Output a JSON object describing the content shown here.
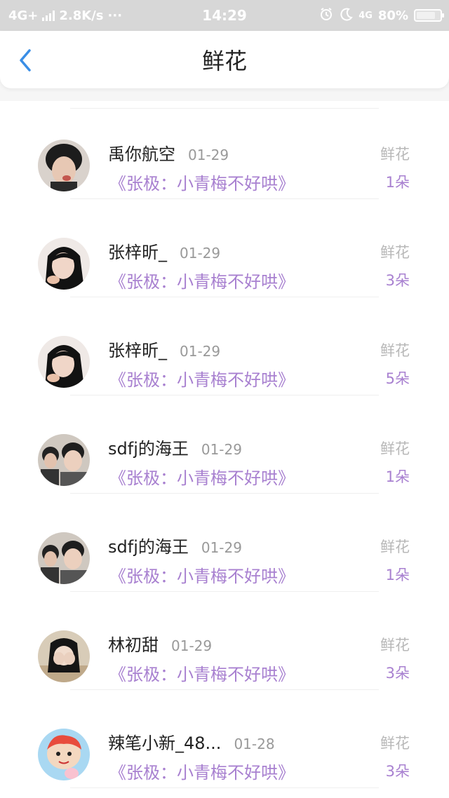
{
  "status_bar": {
    "network": "4G+",
    "speed": "2.8K/s",
    "more": "···",
    "time": "14:29",
    "right_network": "4G",
    "battery_percent": "80%",
    "battery_level": 0.8
  },
  "header": {
    "title": "鲜花",
    "back_icon": "chevron-left-icon",
    "accent_color": "#3a8ee6"
  },
  "colors": {
    "purple": "#a880d0",
    "label_gray": "#b8b8b8"
  },
  "items": [
    {
      "name": "禹你航空",
      "date": "01-29",
      "book": "《张极：小青梅不好哄》",
      "gift_label": "鲜花",
      "gift_count": "1朵"
    },
    {
      "name": "张梓昕_",
      "date": "01-29",
      "book": "《张极：小青梅不好哄》",
      "gift_label": "鲜花",
      "gift_count": "3朵"
    },
    {
      "name": "张梓昕_",
      "date": "01-29",
      "book": "《张极：小青梅不好哄》",
      "gift_label": "鲜花",
      "gift_count": "5朵"
    },
    {
      "name": "sdfj的海王",
      "date": "01-29",
      "book": "《张极：小青梅不好哄》",
      "gift_label": "鲜花",
      "gift_count": "1朵"
    },
    {
      "name": "sdfj的海王",
      "date": "01-29",
      "book": "《张极：小青梅不好哄》",
      "gift_label": "鲜花",
      "gift_count": "1朵"
    },
    {
      "name": "林初甜",
      "date": "01-29",
      "book": "《张极：小青梅不好哄》",
      "gift_label": "鲜花",
      "gift_count": "3朵"
    },
    {
      "name": "辣笔小新_48...",
      "date": "01-28",
      "book": "《张极：小青梅不好哄》",
      "gift_label": "鲜花",
      "gift_count": "3朵"
    }
  ]
}
